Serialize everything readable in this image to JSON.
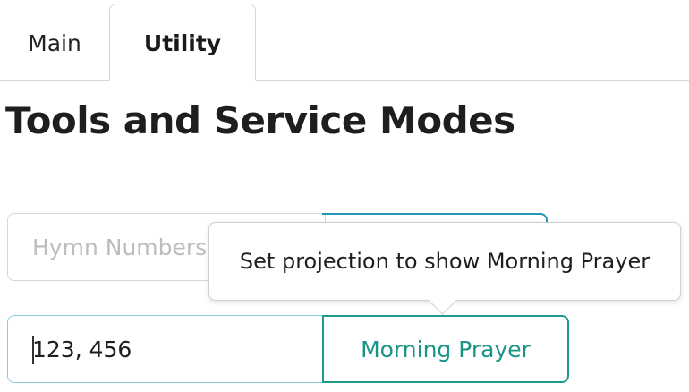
{
  "tabs": [
    {
      "label": "Main",
      "active": false
    },
    {
      "label": "Utility",
      "active": true
    }
  ],
  "page_title": "Tools and Service Modes",
  "hymn_numbers": {
    "placeholder": "Hymn Numbers..."
  },
  "numbers_field": {
    "value": "123, 456"
  },
  "morning_prayer_button": {
    "label": "Morning Prayer"
  },
  "tooltip": {
    "text": "Set projection to show Morning Prayer"
  },
  "colors": {
    "accent_teal": "#1d9c8e",
    "accent_blue": "#2496b3"
  }
}
